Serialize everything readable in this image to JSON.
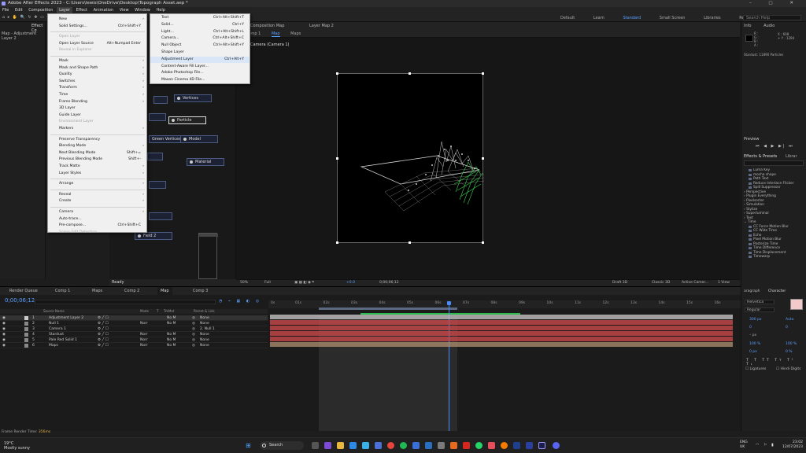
{
  "title_bar": {
    "text": "Adobe After Effects 2023 - C:\\Users\\lewis\\OneDrive\\Desktop\\Topograph Asset.aep *",
    "window_buttons": "– ▢ ✕"
  },
  "menu_bar": [
    "File",
    "Edit",
    "Composition",
    "Layer",
    "Effect",
    "Animation",
    "View",
    "Window",
    "Help"
  ],
  "toolbar": {
    "workspaces": [
      "Default",
      "Learn",
      "Standard",
      "Small Screen",
      "Libraries",
      "Review"
    ],
    "active_workspace": "Standard",
    "help_placeholder": "Search Help"
  },
  "left_panel": {
    "header": "Map - Adjustment Layer 2",
    "tab": "Effect Co"
  },
  "composition": {
    "top_tabs": [
      "Composition Map",
      "Layer Map 2"
    ],
    "sub_tabs": [
      "Comp 1",
      "Map",
      "Maps"
    ],
    "active_sub_tab": "Map",
    "camera_label": "Camera (Camera 1)",
    "flow_partial": "pping"
  },
  "flowchart_nodes": [
    {
      "label": "Vertices"
    },
    {
      "label": "Particle"
    },
    {
      "label": "Green Vertices"
    },
    {
      "label": "Model"
    },
    {
      "label": "Material"
    },
    {
      "label": "Field 2"
    }
  ],
  "ready_text": "Ready",
  "viewer_bar": {
    "zoom": "50%",
    "resolution": "Full",
    "exposure": "+0.0",
    "timecode": "0;00;06;12",
    "draft": "Draft 3D",
    "renderer": "Classic 3D",
    "camera": "Active Camer...",
    "views": "1 View"
  },
  "right_panel": {
    "info_tabs": [
      "Info",
      "Audio"
    ],
    "info_values": [
      "R :",
      "G :",
      "B :",
      "A :",
      "X : 608",
      "+ Y : 1294"
    ],
    "stardust_text": "Stardust: 11890 Particles",
    "preview_tab": "Preview",
    "effects_tab": "Effects & Presets",
    "libraries_tab": "Librar",
    "effects_items": [
      {
        "label": "Luma Key",
        "sub": true
      },
      {
        "label": "mocha shape",
        "sub": true
      },
      {
        "label": "Path Text",
        "sub": true
      },
      {
        "label": "Reduce Interlace Flicker",
        "sub": true
      },
      {
        "label": "Spill Suppressor",
        "sub": true
      },
      {
        "label": "› Perspective",
        "sub": false
      },
      {
        "label": "› Plugin Everything",
        "sub": false
      },
      {
        "label": "› Pixelsorter",
        "sub": false
      },
      {
        "label": "› Simulation",
        "sub": false
      },
      {
        "label": "› Stylize",
        "sub": false
      },
      {
        "label": "› Superluminal",
        "sub": false
      },
      {
        "label": "› Text",
        "sub": false
      },
      {
        "label": "⌄ Time",
        "sub": false
      },
      {
        "label": "CC Force Motion Blur",
        "sub": true
      },
      {
        "label": "CC Wide Time",
        "sub": true
      },
      {
        "label": "Echo",
        "sub": true
      },
      {
        "label": "Pixel Motion Blur",
        "sub": true
      },
      {
        "label": "Posterize Time",
        "sub": true
      },
      {
        "label": "Time Difference",
        "sub": true
      },
      {
        "label": "Time Displacement",
        "sub": true
      },
      {
        "label": "Timewarp",
        "sub": true
      }
    ]
  },
  "layer_menu": {
    "items": [
      {
        "label": "New",
        "sc": "",
        "arrow": true,
        "dis": false
      },
      {
        "label": "Solid Settings...",
        "sc": "Ctrl+Shift+Y",
        "dis": false
      },
      {
        "sep": true
      },
      {
        "label": "Open Layer",
        "sc": "",
        "dis": true
      },
      {
        "label": "Open Layer Source",
        "sc": "Alt+Numpad Enter",
        "dis": false
      },
      {
        "label": "Reveal in Explorer",
        "sc": "",
        "dis": true
      },
      {
        "sep": true
      },
      {
        "label": "Mask",
        "sc": "",
        "arrow": true,
        "dis": false
      },
      {
        "label": "Mask and Shape Path",
        "sc": "",
        "arrow": true,
        "dis": false
      },
      {
        "label": "Quality",
        "sc": "",
        "arrow": true,
        "dis": false
      },
      {
        "label": "Switches",
        "sc": "",
        "arrow": true,
        "dis": false
      },
      {
        "label": "Transform",
        "sc": "",
        "arrow": true,
        "dis": false
      },
      {
        "label": "Time",
        "sc": "",
        "arrow": true,
        "dis": false
      },
      {
        "label": "Frame Blending",
        "sc": "",
        "arrow": true,
        "dis": false
      },
      {
        "label": "3D Layer",
        "sc": "",
        "dis": false
      },
      {
        "label": "Guide Layer",
        "sc": "",
        "dis": false
      },
      {
        "label": "Environment Layer",
        "sc": "",
        "dis": true
      },
      {
        "label": "Markers",
        "sc": "",
        "arrow": true,
        "dis": false
      },
      {
        "sep": true
      },
      {
        "label": "Preserve Transparency",
        "sc": "",
        "dis": false
      },
      {
        "label": "Blending Mode",
        "sc": "",
        "arrow": true,
        "dis": false
      },
      {
        "label": "Next Blending Mode",
        "sc": "Shift+=",
        "dis": false
      },
      {
        "label": "Previous Blending Mode",
        "sc": "Shift+-",
        "dis": false
      },
      {
        "label": "Track Matte",
        "sc": "",
        "arrow": true,
        "dis": false
      },
      {
        "label": "Layer Styles",
        "sc": "",
        "arrow": true,
        "dis": false
      },
      {
        "sep": true
      },
      {
        "label": "Arrange",
        "sc": "",
        "arrow": true,
        "dis": false
      },
      {
        "sep": true
      },
      {
        "label": "Reveal",
        "sc": "",
        "arrow": true,
        "dis": false
      },
      {
        "label": "Create",
        "sc": "",
        "arrow": true,
        "dis": false
      },
      {
        "sep": true
      },
      {
        "label": "Camera",
        "sc": "",
        "arrow": true,
        "dis": false
      },
      {
        "label": "Auto-trace...",
        "sc": "",
        "dis": false
      },
      {
        "label": "Pre-compose...",
        "sc": "Ctrl+Shift+C",
        "dis": false
      },
      {
        "label": "Scene Edit Detection...",
        "sc": "",
        "dis": true
      }
    ]
  },
  "new_submenu": {
    "items": [
      {
        "label": "Text",
        "sc": "Ctrl+Alt+Shift+T"
      },
      {
        "label": "Solid...",
        "sc": "Ctrl+Y"
      },
      {
        "label": "Light...",
        "sc": "Ctrl+Alt+Shift+L"
      },
      {
        "label": "Camera...",
        "sc": "Ctrl+Alt+Shift+C"
      },
      {
        "label": "Null Object",
        "sc": "Ctrl+Alt+Shift+Y"
      },
      {
        "label": "Shape Layer",
        "sc": ""
      },
      {
        "label": "Adjustment Layer",
        "sc": "Ctrl+Alt+Y",
        "hl": true
      },
      {
        "label": "Content-Aware Fill Layer...",
        "sc": ""
      },
      {
        "label": "Adobe Photoshop File...",
        "sc": ""
      },
      {
        "label": "Maxon Cinema 4D File...",
        "sc": ""
      }
    ]
  },
  "timeline": {
    "tabs": [
      "Render Queue",
      "Comp 1",
      "Maps",
      "Comp 2",
      "Map",
      "Comp 3"
    ],
    "active_tab": "Map",
    "timecode": "0;00;06;12",
    "columns": [
      "Source Name",
      "Mode",
      "T",
      "TrkMat",
      "Parent & Link"
    ],
    "layers": [
      {
        "num": "1",
        "name": "Adjustment Layer 2",
        "mode": "",
        "trk": "No M",
        "parent": "None",
        "color": "#b7b7b7"
      },
      {
        "num": "2",
        "name": "Null 1",
        "mode": "Norr",
        "trk": "No M",
        "parent": "None",
        "color": "#c94848"
      },
      {
        "num": "3",
        "name": "Camera 1",
        "mode": "",
        "trk": "",
        "parent": "2. Null 1",
        "color": "#c94848"
      },
      {
        "num": "4",
        "name": "Stardust",
        "mode": "Norr",
        "trk": "No M",
        "parent": "None",
        "color": "#c94848"
      },
      {
        "num": "5",
        "name": "Pale Red Solid 1",
        "mode": "Norr",
        "trk": "No M",
        "parent": "None",
        "color": "#c94848"
      },
      {
        "num": "6",
        "name": "Maps",
        "mode": "Norr",
        "trk": "No M",
        "parent": "None",
        "color": "#a8896b"
      }
    ],
    "ruler_labels": [
      "0s",
      "01s",
      "02s",
      "03s",
      "04s",
      "05s",
      "06s",
      "07s",
      "08s",
      "09s",
      "10s",
      "11s",
      "12s",
      "13s",
      "14s",
      "15s",
      "16s"
    ],
    "frame_render_label": "Frame Render Time:",
    "frame_render_value": "356ms"
  },
  "character_panel": {
    "tabs": [
      "aragraph",
      "Character"
    ],
    "font": "Helvetica",
    "style": "Regular",
    "size": "300 px",
    "leading": "Auto",
    "kerning": "0",
    "tracking": "0",
    "stroke": "– px",
    "vscale": "100 %",
    "hscale": "100 %",
    "baseline": "0 px",
    "tsume": "0 %",
    "ligatures": "Ligatures",
    "hindi": "Hindi Digits"
  },
  "taskbar": {
    "weather_temp": "19°C",
    "weather_desc": "Mostly sunny",
    "search": "Search",
    "lang1": "ENG",
    "lang2": "UK",
    "time": "23:02",
    "date": "12/07/2023"
  },
  "colors": {
    "accent": "#4a8cff",
    "menu_bg": "#f0f0f0",
    "menu_highlight": "#d8e6f7",
    "layer_red": "#b04a4a",
    "green_mesh": "#3ccf52"
  }
}
